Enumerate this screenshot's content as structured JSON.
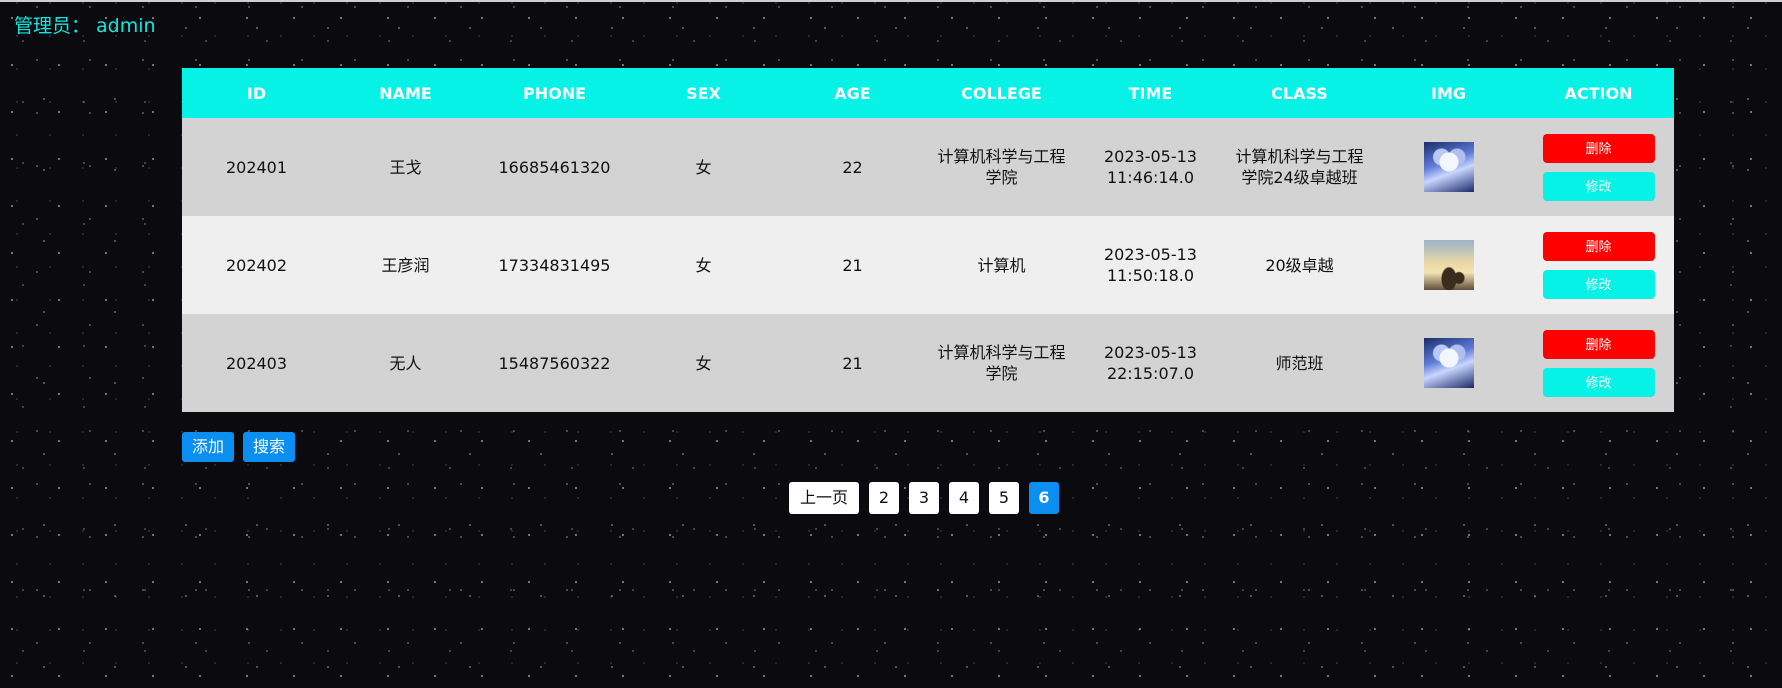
{
  "header": {
    "admin_label": "管理员：",
    "admin_name": "admin"
  },
  "table": {
    "columns": [
      "ID",
      "NAME",
      "PHONE",
      "SEX",
      "AGE",
      "COLLEGE",
      "TIME",
      "CLASS",
      "IMG",
      "ACTION"
    ],
    "rows": [
      {
        "id": "202401",
        "name": "王戈",
        "phone": "16685461320",
        "sex": "女",
        "age": "22",
        "college": "计算机科学与工程学院",
        "time": "2023-05-13 11:46:14.0",
        "class": "计算机科学与工程学院24级卓越班",
        "img": "anime-avatar-image",
        "delete_label": "删除",
        "edit_label": "修改"
      },
      {
        "id": "202402",
        "name": "王彦润",
        "phone": "17334831495",
        "sex": "女",
        "age": "21",
        "college": "计算机",
        "time": "2023-05-13 11:50:18.0",
        "class": "20级卓越",
        "img": "deer-sunset-image",
        "delete_label": "删除",
        "edit_label": "修改"
      },
      {
        "id": "202403",
        "name": "无人",
        "phone": "15487560322",
        "sex": "女",
        "age": "21",
        "college": "计算机科学与工程学院",
        "time": "2023-05-13 22:15:07.0",
        "class": "师范班",
        "img": "anime-avatar-image",
        "delete_label": "删除",
        "edit_label": "修改"
      }
    ]
  },
  "controls": {
    "add_label": "添加",
    "search_label": "搜索"
  },
  "pagination": {
    "prev_label": "上一页",
    "pages": [
      "2",
      "3",
      "4",
      "5",
      "6"
    ],
    "active_page": "6"
  },
  "colors": {
    "header_bg": "#06f2e6",
    "delete_button": "#ff0000",
    "edit_button": "#06f2e6",
    "primary_button": "#0a8ff0",
    "admin_text": "#10e8de"
  }
}
